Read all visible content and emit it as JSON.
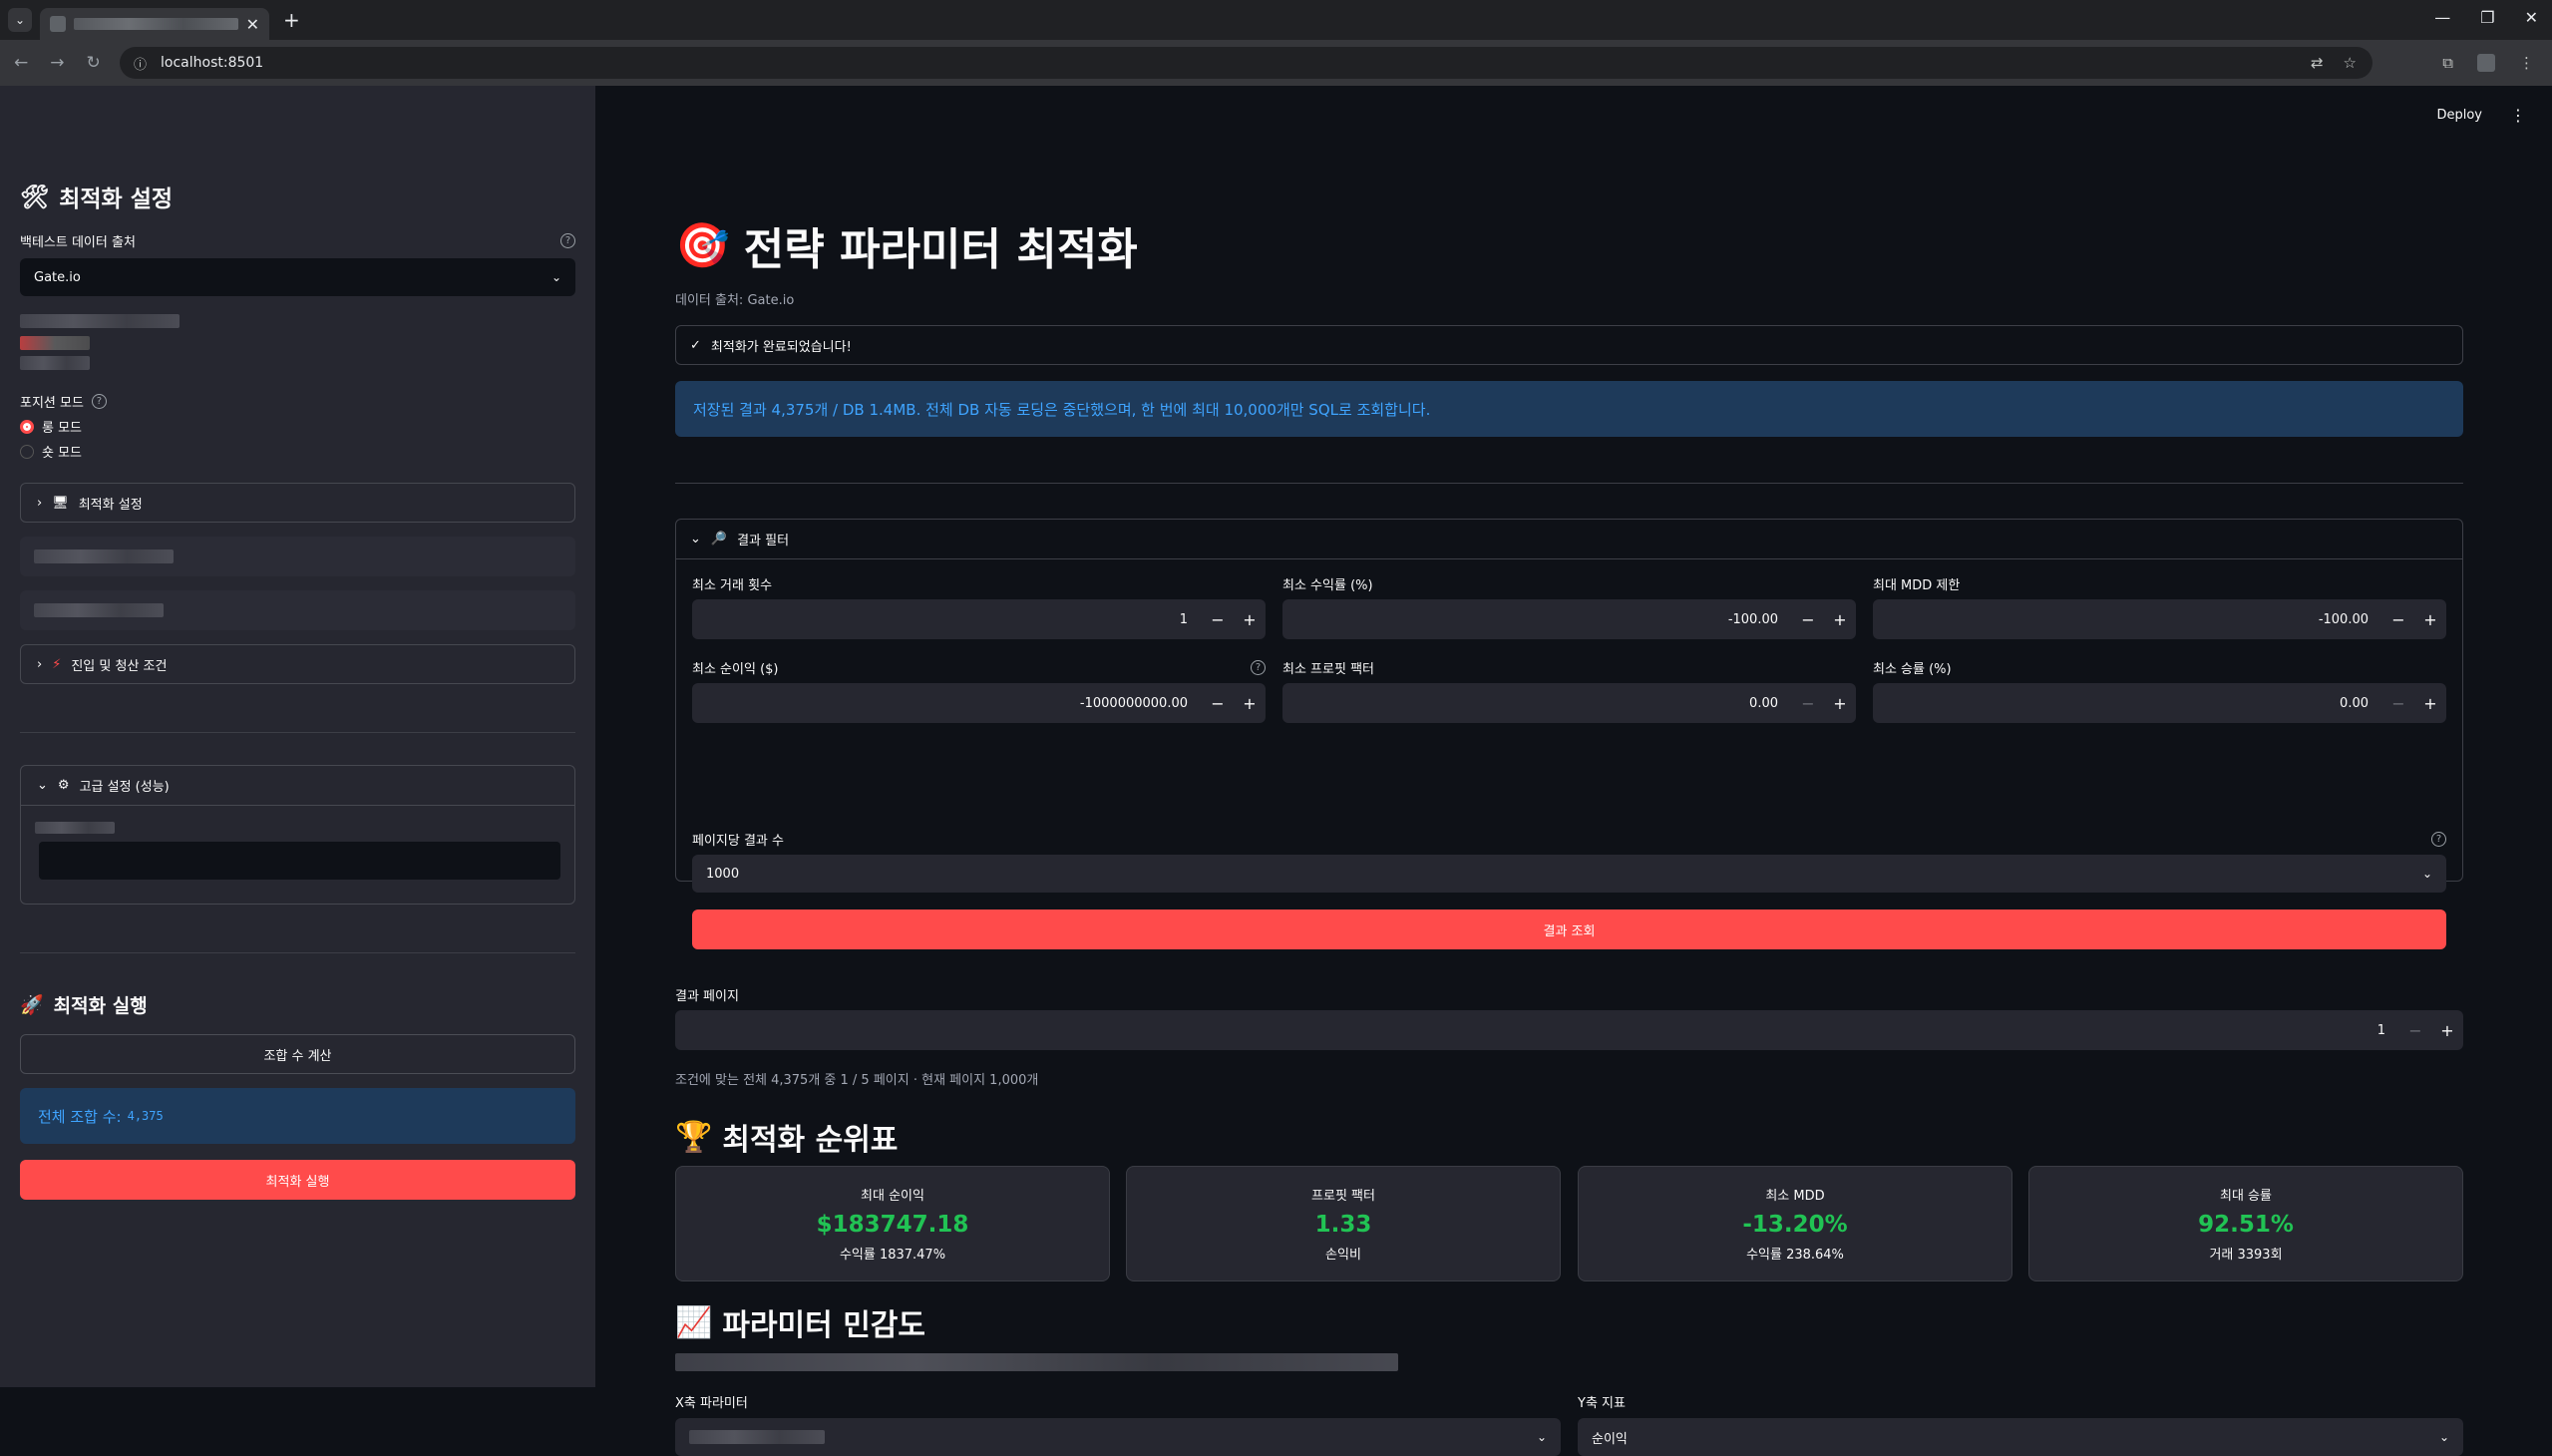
{
  "browser": {
    "url": "localhost:8501"
  },
  "header": {
    "deploy_label": "Deploy"
  },
  "sidebar": {
    "settings_title": "최적화 설정",
    "data_source_label": "백테스트 데이터 출처",
    "data_source_value": "Gate.io",
    "position_mode_label": "포지션 모드",
    "long_mode": "롱 모드",
    "short_mode": "숏 모드",
    "optimize_settings_expander": "최적화 설정",
    "entry_exit_expander": "진입 및 청산 조건",
    "advanced_expander": "고급 설정 (성능)",
    "run_title": "최적화 실행",
    "count_button": "조합 수 계산",
    "total_combos_label": "전체 조합 수:",
    "total_combos_value": "4,375",
    "run_button": "최적화 실행"
  },
  "main": {
    "title": "전략 파라미터 최적화",
    "data_source_caption": "데이터 출처: Gate.io",
    "success_message": "최적화가 완료되었습니다!",
    "info_message": "저장된 결과 4,375개 / DB 1.4MB. 전체 DB 자동 로딩은 중단했으며, 한 번에 최대 10,000개만 SQL로 조회합니다.",
    "filter_expander": "결과 필터",
    "filters": {
      "min_trades_label": "최소 거래 횟수",
      "min_trades_value": "1",
      "min_return_label": "최소 수익률 (%)",
      "min_return_value": "-100.00",
      "max_mdd_label": "최대 MDD 제한",
      "max_mdd_value": "-100.00",
      "min_profit_label": "최소 순이익 ($)",
      "min_profit_value": "-1000000000.00",
      "min_pf_label": "최소 프로핏 팩터",
      "min_pf_value": "0.00",
      "min_winrate_label": "최소 승률 (%)",
      "min_winrate_value": "0.00",
      "per_page_label": "페이지당 결과 수",
      "per_page_value": "1000"
    },
    "query_button": "결과 조회",
    "result_page_label": "결과 페이지",
    "result_page_value": "1",
    "page_caption": "조건에 맞는 전체 4,375개 중 1 / 5 페이지 · 현재 페이지 1,000개",
    "leaderboard_title": "최적화 순위표",
    "metrics": [
      {
        "label": "최대 순이익",
        "value": "$183747.18",
        "delta": "수익률 1837.47%"
      },
      {
        "label": "프로핏 팩터",
        "value": "1.33",
        "delta": "손익비"
      },
      {
        "label": "최소 MDD",
        "value": "-13.20%",
        "delta": "수익률 238.64%"
      },
      {
        "label": "최대 승률",
        "value": "92.51%",
        "delta": "거래 3393회"
      }
    ],
    "sensitivity_title": "파라미터 민감도",
    "x_param_label": "X축 파라미터",
    "y_metric_label": "Y축 지표",
    "y_metric_value": "순이익"
  },
  "icons": {
    "tools": "🛠",
    "target": "🎯",
    "trophy": "🏆",
    "chart": "📈",
    "rocket": "🚀",
    "search": "🔎",
    "gear": "⚙",
    "bolt": "⚡",
    "desktop": "🖥"
  }
}
